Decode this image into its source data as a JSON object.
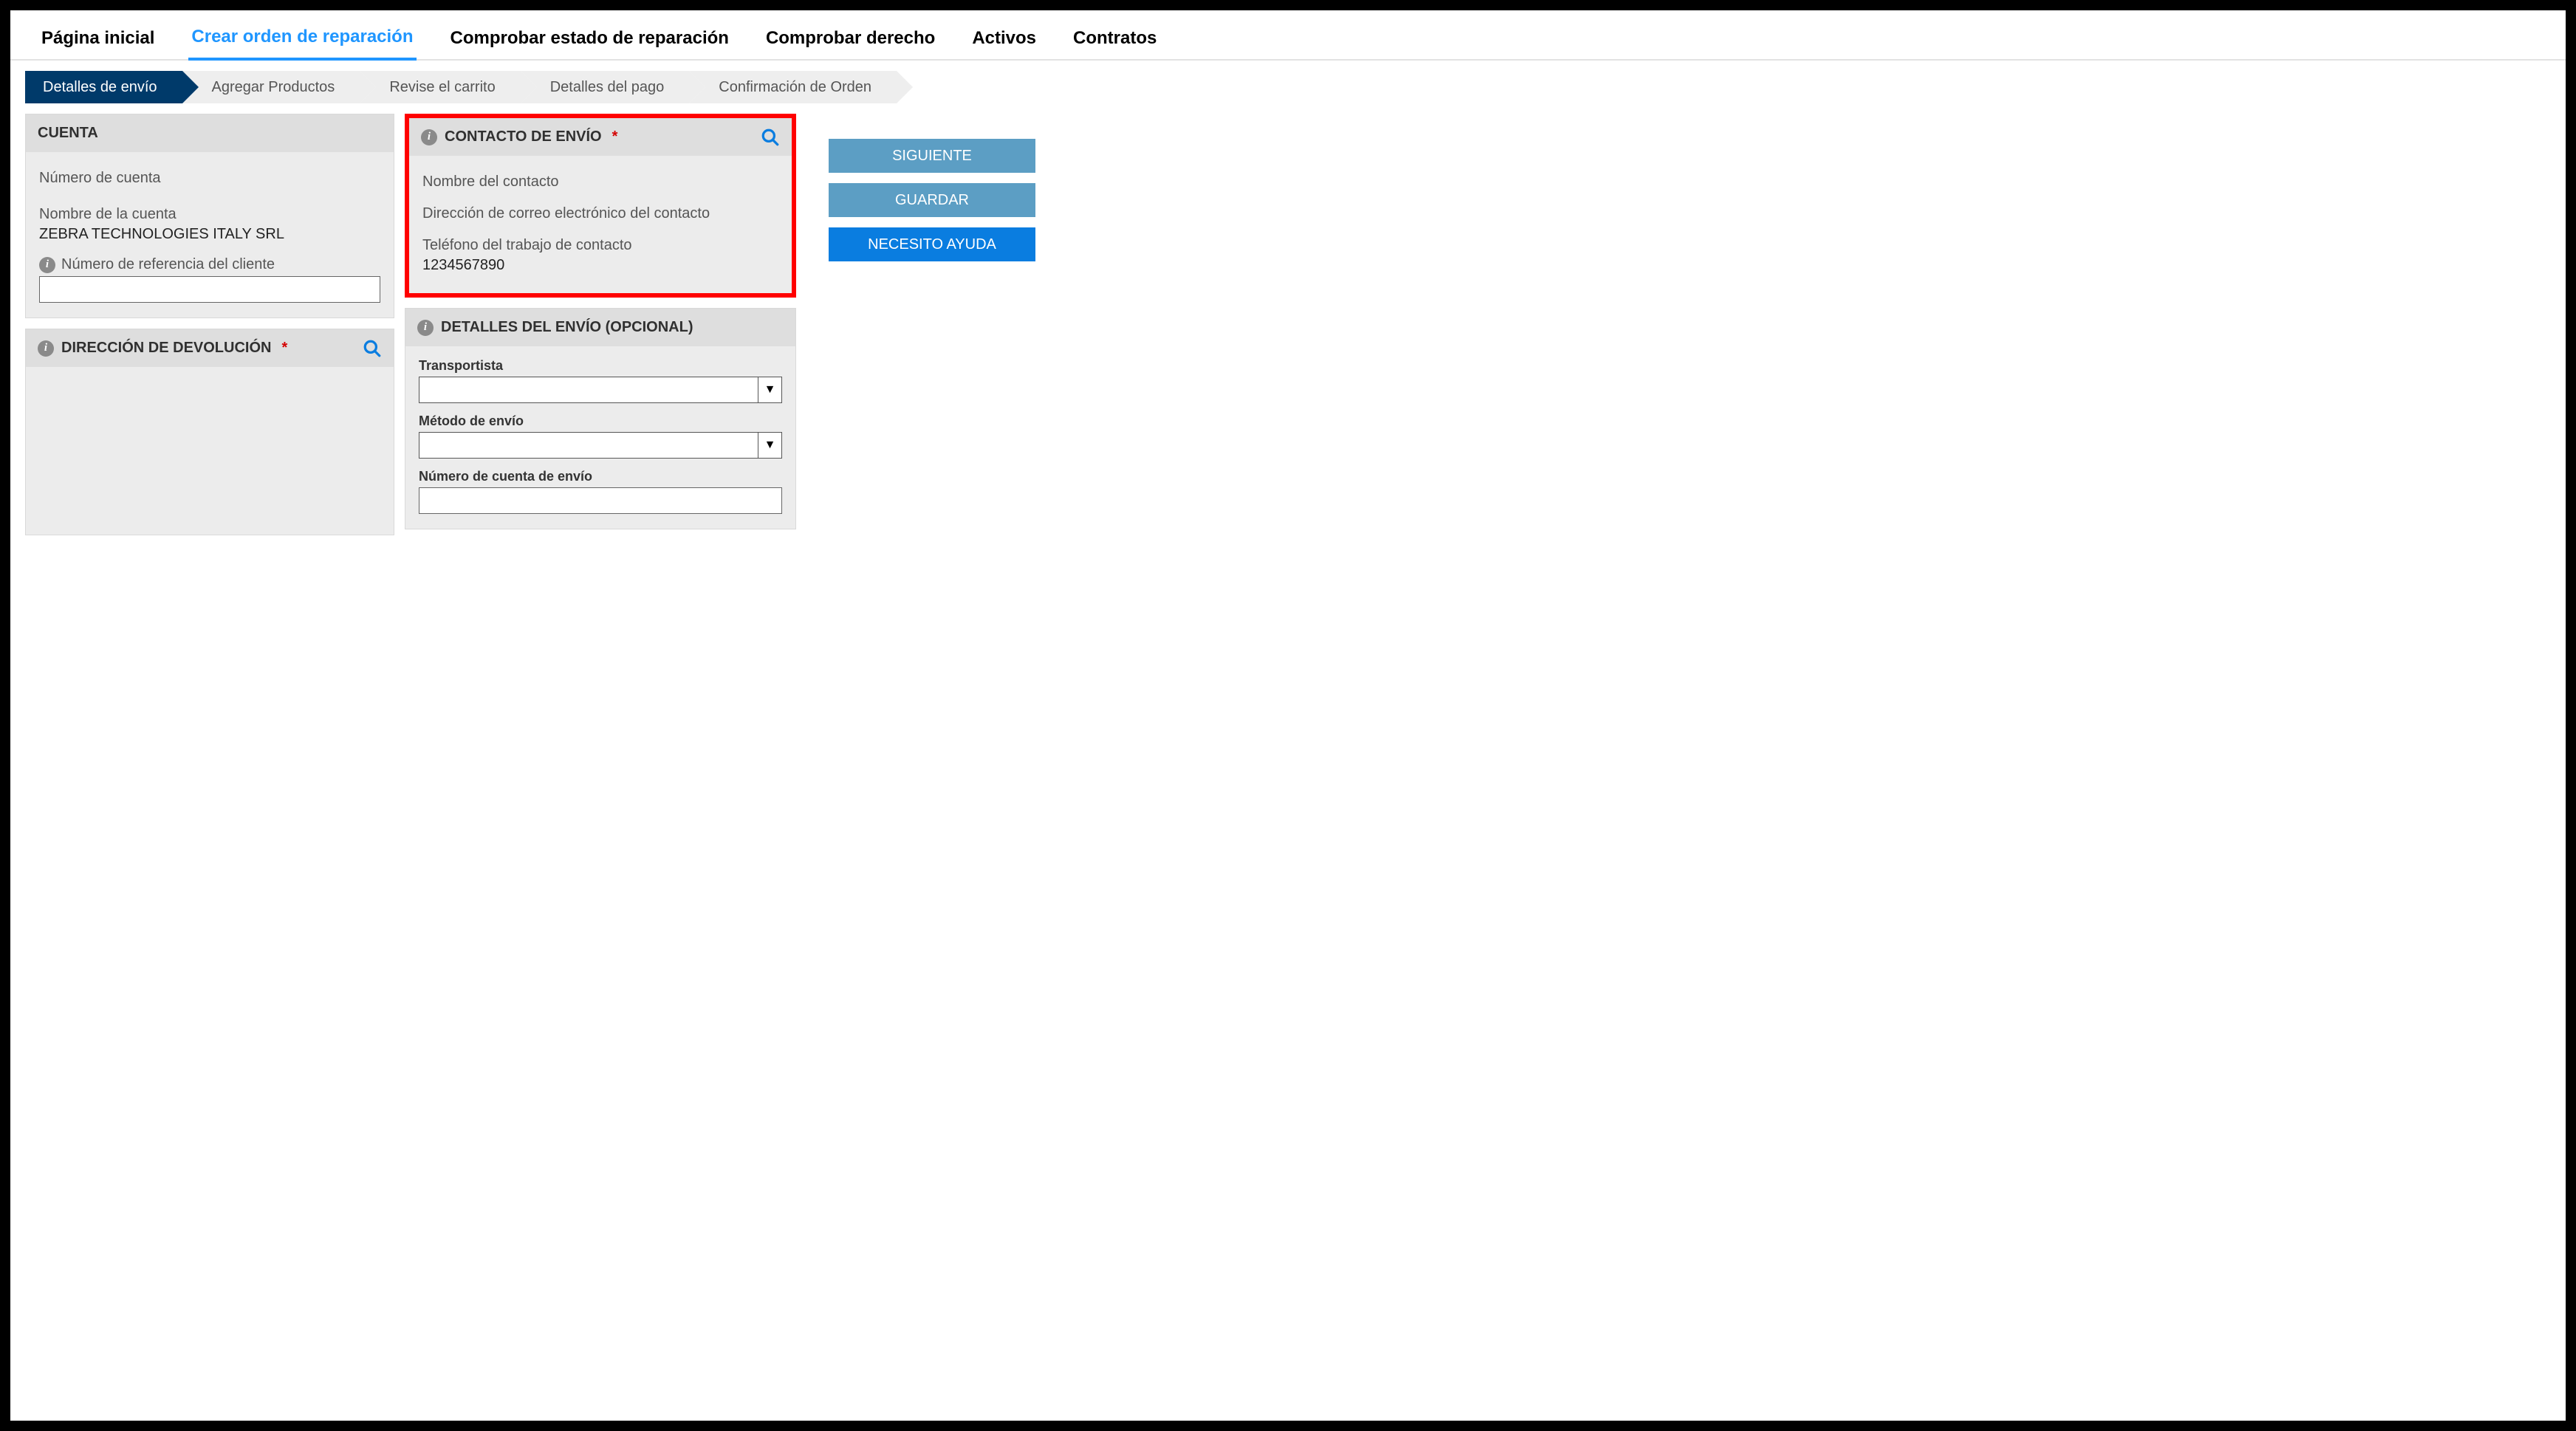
{
  "topnav": {
    "items": [
      {
        "label": "Página inicial"
      },
      {
        "label": "Crear orden de reparación",
        "active": true
      },
      {
        "label": "Comprobar estado de reparación"
      },
      {
        "label": "Comprobar derecho"
      },
      {
        "label": "Activos"
      },
      {
        "label": "Contratos"
      }
    ]
  },
  "stepper": {
    "steps": [
      {
        "label": "Detalles de envío",
        "active": true
      },
      {
        "label": "Agregar Productos"
      },
      {
        "label": "Revise el carrito"
      },
      {
        "label": "Detalles del pago"
      },
      {
        "label": "Confirmación de Orden"
      }
    ]
  },
  "account_panel": {
    "title": "CUENTA",
    "account_number_label": "Número de cuenta",
    "account_number_value": "",
    "account_name_label": "Nombre de la cuenta",
    "account_name_value": "ZEBRA TECHNOLOGIES ITALY SRL",
    "customer_ref_label": "Número de referencia del cliente",
    "customer_ref_value": ""
  },
  "return_address_panel": {
    "title": "DIRECCIÓN DE DEVOLUCIÓN",
    "required_mark": "*"
  },
  "shipping_contact_panel": {
    "title": "CONTACTO DE ENVÍO",
    "required_mark": "*",
    "contact_name_label": "Nombre del contacto",
    "contact_name_value": "",
    "email_label": "Dirección de correo electrónico del contacto",
    "email_value": "",
    "phone_label": "Teléfono del trabajo de contacto",
    "phone_value": "1234567890"
  },
  "shipping_details_panel": {
    "title": "DETALLES DEL ENVÍO (OPCIONAL)",
    "carrier_label": "Transportista",
    "method_label": "Método de envío",
    "shipping_account_label": "Número de cuenta de envío",
    "shipping_account_value": ""
  },
  "buttons": {
    "next": "SIGUIENTE",
    "save": "GUARDAR",
    "help": "NECESITO AYUDA"
  }
}
